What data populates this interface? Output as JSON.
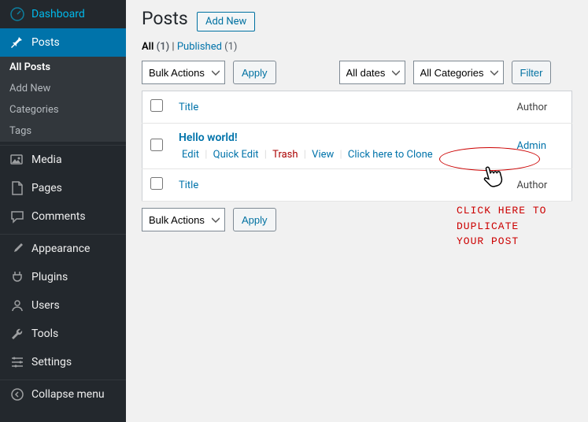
{
  "sidebar": {
    "items": [
      {
        "label": "Dashboard",
        "icon": "dashboard"
      },
      {
        "label": "Posts",
        "icon": "pin"
      },
      {
        "label": "Media",
        "icon": "media"
      },
      {
        "label": "Pages",
        "icon": "page"
      },
      {
        "label": "Comments",
        "icon": "comment"
      },
      {
        "label": "Appearance",
        "icon": "brush"
      },
      {
        "label": "Plugins",
        "icon": "plug"
      },
      {
        "label": "Users",
        "icon": "users"
      },
      {
        "label": "Tools",
        "icon": "wrench"
      },
      {
        "label": "Settings",
        "icon": "sliders"
      },
      {
        "label": "Collapse menu",
        "icon": "collapse"
      }
    ],
    "submenu": [
      {
        "label": "All Posts",
        "active": true
      },
      {
        "label": "Add New",
        "active": false
      },
      {
        "label": "Categories",
        "active": false
      },
      {
        "label": "Tags",
        "active": false
      }
    ]
  },
  "heading": "Posts",
  "add_new": "Add New",
  "filters": {
    "all_label": "All",
    "all_count": "(1)",
    "published_label": "Published",
    "published_count": "(1)",
    "separator": " | "
  },
  "bulk_actions": {
    "label": "Bulk Actions",
    "apply": "Apply"
  },
  "date_filter": {
    "label": "All dates"
  },
  "cat_filter": {
    "label": "All Categories"
  },
  "filter_btn": "Filter",
  "table": {
    "columns": {
      "title": "Title",
      "author": "Author"
    },
    "rows": [
      {
        "title": "Hello world!",
        "author": "Admin",
        "actions": {
          "edit": "Edit",
          "quick_edit": "Quick Edit",
          "trash": "Trash",
          "view": "View",
          "clone": "Click here to Clone"
        }
      }
    ]
  },
  "annotation": {
    "line1": "CLICK HERE TO DUPLICATE",
    "line2": "YOUR POST"
  }
}
